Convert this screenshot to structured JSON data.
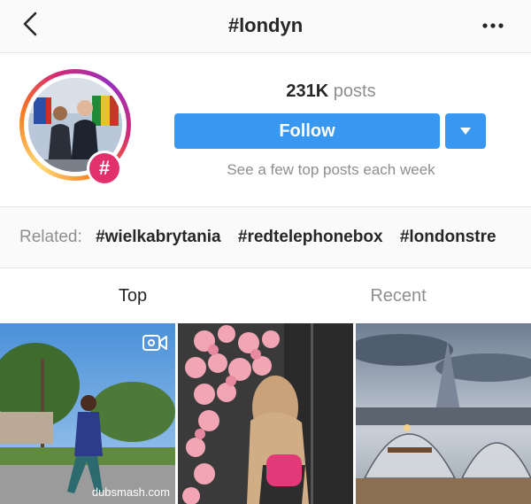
{
  "topbar": {
    "title": "#londyn",
    "back_icon": "chevron-left-icon",
    "more_icon": "more-horizontal-icon"
  },
  "header": {
    "posts_count": "231K",
    "posts_label": "posts",
    "follow_label": "Follow",
    "dropdown_icon": "caret-down-icon",
    "subtitle": "See a few top posts each week",
    "badge_symbol": "#"
  },
  "related": {
    "label": "Related:",
    "tags": [
      "#wielkabrytania",
      "#redtelephonebox",
      "#londonstre"
    ]
  },
  "tabs": {
    "top": "Top",
    "recent": "Recent"
  },
  "grid": {
    "tiles": [
      {
        "type": "video",
        "watermark": "dubsmash.com"
      },
      {
        "type": "photo"
      },
      {
        "type": "photo"
      }
    ]
  },
  "colors": {
    "accent": "#3897f0",
    "hashtag_badge": "#e1306c",
    "muted_text": "#8e8e8e",
    "primary_text": "#262626"
  }
}
